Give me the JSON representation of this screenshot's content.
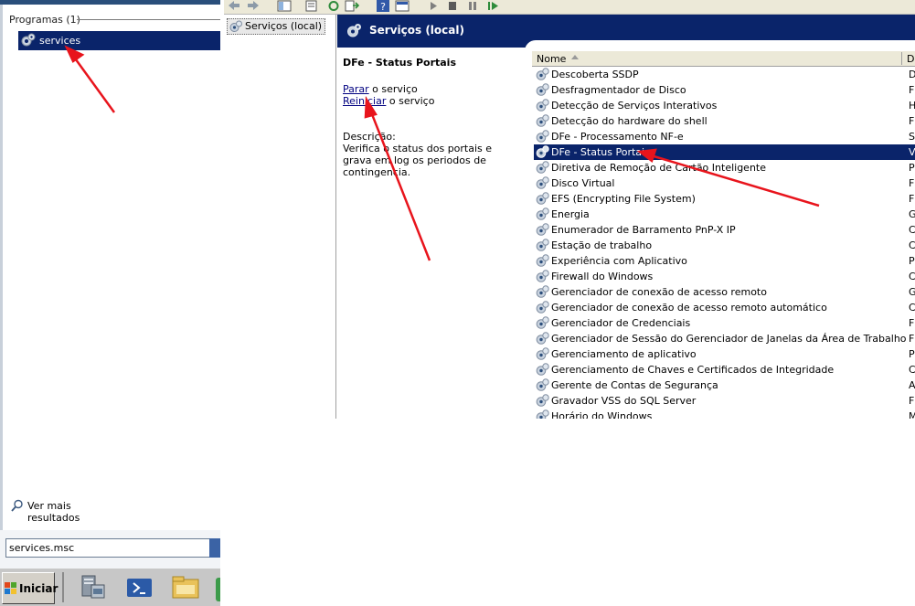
{
  "start_menu": {
    "programs_header": "Programas (1)",
    "result_label": "services",
    "see_more": "Ver mais resultados",
    "search_value": "services.msc"
  },
  "taskbar": {
    "start_label": "Iniciar",
    "icons": [
      "server-manager-icon",
      "powershell-icon",
      "explorer-icon"
    ]
  },
  "mmc": {
    "tree_label": "Serviços (local)",
    "header_title": "Serviços (local)",
    "detail": {
      "title": "DFe - Status Portais",
      "action1_link": "Parar",
      "action1_rest": " o serviço",
      "action2_link": "Reiniciar",
      "action2_rest": " o serviço",
      "desc_label": "Descrição:",
      "desc_text": "Verifica o status dos portais e grava em log os periodos de contingencia."
    },
    "list": {
      "col_name": "Nome",
      "col_desc": "D",
      "selected_index": 5,
      "rows": [
        {
          "name": "Descoberta SSDP",
          "d": "D"
        },
        {
          "name": "Desfragmentador de Disco",
          "d": "F"
        },
        {
          "name": "Detecção de Serviços Interativos",
          "d": "H"
        },
        {
          "name": "Detecção do hardware do shell",
          "d": "F"
        },
        {
          "name": "DFe - Processamento NF-e",
          "d": "S"
        },
        {
          "name": "DFe - Status Portais",
          "d": "V"
        },
        {
          "name": "Diretiva de Remoção de Cartão Inteligente",
          "d": "P"
        },
        {
          "name": "Disco Virtual",
          "d": "F"
        },
        {
          "name": "EFS (Encrypting File System)",
          "d": "F"
        },
        {
          "name": "Energia",
          "d": "G"
        },
        {
          "name": "Enumerador de Barramento PnP-X IP",
          "d": "C"
        },
        {
          "name": "Estação de trabalho",
          "d": "C"
        },
        {
          "name": "Experiência com Aplicativo",
          "d": "P"
        },
        {
          "name": "Firewall do Windows",
          "d": "C"
        },
        {
          "name": "Gerenciador de conexão de acesso remoto",
          "d": "G"
        },
        {
          "name": "Gerenciador de conexão de acesso remoto automático",
          "d": "C"
        },
        {
          "name": "Gerenciador de Credenciais",
          "d": "F"
        },
        {
          "name": "Gerenciador de Sessão do Gerenciador de Janelas da Área de Trabalho",
          "d": "F"
        },
        {
          "name": "Gerenciamento de aplicativo",
          "d": "P"
        },
        {
          "name": "Gerenciamento de Chaves e Certificados de Integridade",
          "d": "C"
        },
        {
          "name": "Gerente de Contas de Segurança",
          "d": "A"
        },
        {
          "name": "Gravador VSS do SQL Server",
          "d": "F"
        },
        {
          "name": "Horário do Windows",
          "d": "M"
        }
      ]
    }
  },
  "colors": {
    "selection": "#0a246a",
    "annotation_arrow": "#e8141c"
  }
}
